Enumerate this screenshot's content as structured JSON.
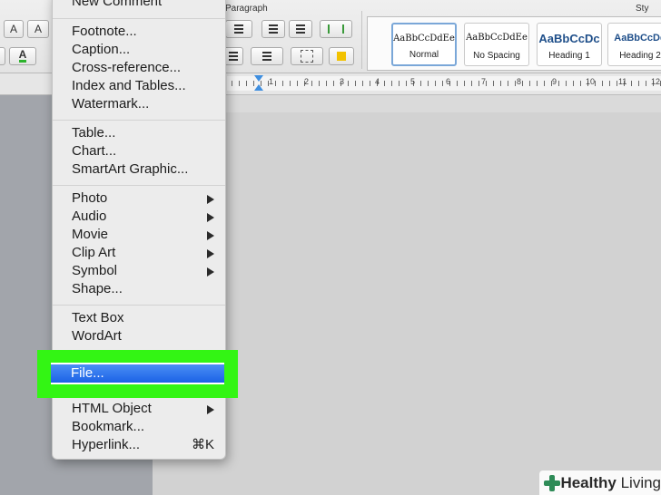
{
  "ribbon": {
    "paragraph_label": "Paragraph",
    "styles_label": "Sty",
    "font_size_up": "A",
    "font_size_down": "A",
    "font_color": "A",
    "styles": [
      {
        "sample": "AaBbCcDdEe",
        "name": "Normal"
      },
      {
        "sample": "AaBbCcDdEe",
        "name": "No Spacing"
      },
      {
        "sample": "AaBbCcDc",
        "name": "Heading 1"
      },
      {
        "sample": "AaBbCcDd",
        "name": "Heading 2"
      }
    ]
  },
  "ruler": {
    "numbers": [
      "1",
      "2",
      "3",
      "4",
      "5",
      "6",
      "7",
      "8",
      "9",
      "10",
      "11",
      "12"
    ]
  },
  "menu": {
    "top_item": "New Comment",
    "group1": [
      "Footnote...",
      "Caption...",
      "Cross-reference...",
      "Index and Tables...",
      "Watermark..."
    ],
    "group2": [
      "Table...",
      "Chart...",
      "SmartArt Graphic..."
    ],
    "group3": [
      "Photo",
      "Audio",
      "Movie",
      "Clip Art",
      "Symbol",
      "Shape..."
    ],
    "group4": [
      "Text Box",
      "WordArt"
    ],
    "selected": "File...",
    "group5": [
      "HTML Object",
      "Bookmark...",
      "Hyperlink..."
    ],
    "hyperlink_shortcut": "⌘K"
  },
  "watermark": {
    "brand_bold": "Healthy",
    "brand_rest": " Living"
  },
  "colors": {
    "highlight_frame": "#33f514",
    "selection": "#1b62e6",
    "font_color_bar": "#2cb32c"
  }
}
